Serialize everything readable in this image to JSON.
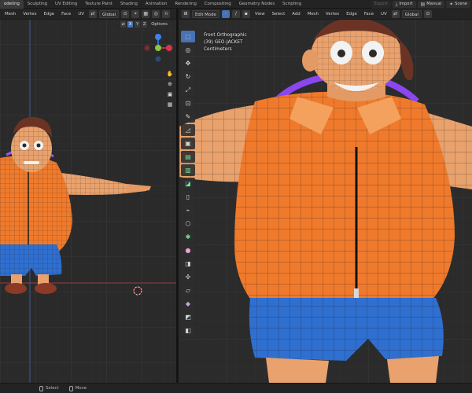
{
  "workspace_tabs": [
    "odeling",
    "Sculpting",
    "UV Editing",
    "Texture Paint",
    "Shading",
    "Animation",
    "Rendering",
    "Compositing",
    "Geometry Nodes",
    "Scripting"
  ],
  "active_tab_index": 0,
  "topright": {
    "export_label": "Export",
    "import_label": "Import",
    "manual_label": "Manual",
    "scene_label": "Scene"
  },
  "left_viewport": {
    "menu": [
      "Mesh",
      "Vertex",
      "Edge",
      "Face",
      "UV"
    ],
    "transform_orientation": "Global",
    "axes": [
      "X",
      "Y",
      "Z"
    ],
    "axis_prefix": "⇄",
    "options_label": "Options"
  },
  "right_viewport": {
    "mode": "Edit Mode",
    "menu": [
      "View",
      "Select",
      "Add",
      "Mesh",
      "Vertex",
      "Edge",
      "Face",
      "UV"
    ],
    "transform_orientation": "Global",
    "overlay": {
      "view_name": "Front Orthographic",
      "object_info": "(39) GEO-JACKET",
      "units": "Centimeters"
    }
  },
  "statusbar": {
    "select_label": "Select",
    "move_label": "Move"
  },
  "colors": {
    "accent": "#4772b3",
    "jacket": "#f07a2c",
    "shorts": "#2f6fd0",
    "skin": "#e9a26d",
    "hair": "#6b3324",
    "collar_rim": "#7b3be0",
    "x_axis": "#d9364a",
    "y_axis": "#8cc63f",
    "z_axis": "#3b82f6"
  },
  "icons": {
    "cursor": "select-box-icon",
    "move": "move-icon",
    "rotate": "rotate-icon",
    "scale": "scale-icon"
  }
}
